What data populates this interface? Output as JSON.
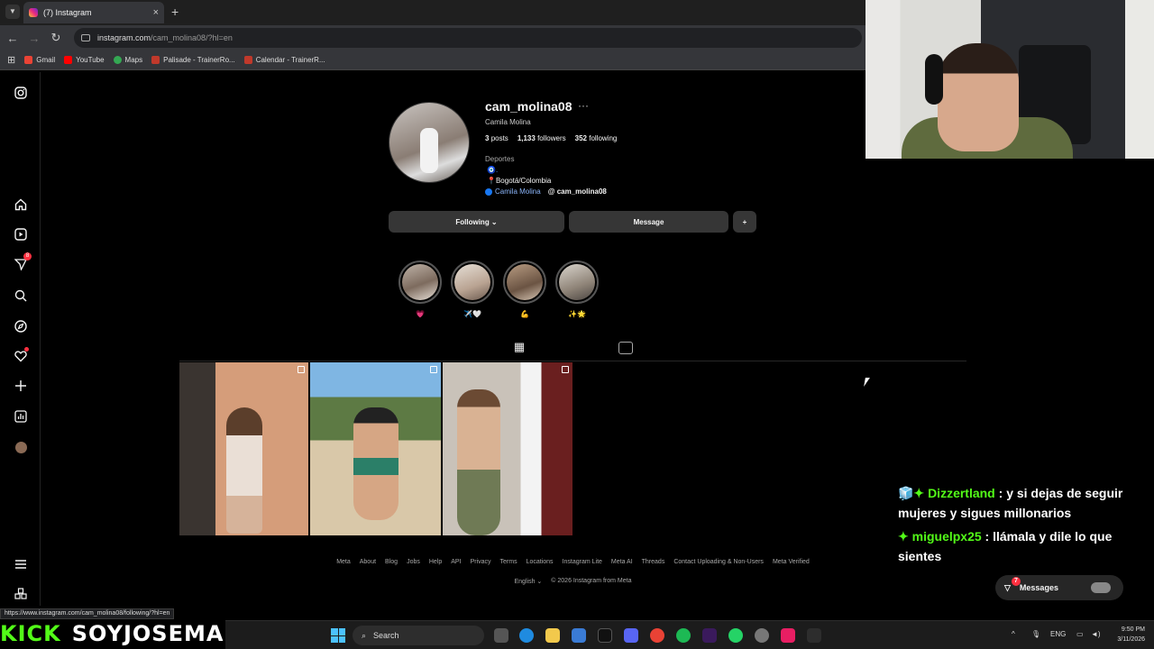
{
  "browser": {
    "tab_title": "(7) Instagram",
    "url_host": "instagram.com",
    "url_path": "/cam_molina08/?hl=en",
    "status_url": "https://www.instagram.com/cam_molina08/following/?hl=en",
    "bookmarks": [
      {
        "label": "Gmail",
        "color": "#ea4335"
      },
      {
        "label": "YouTube",
        "color": "#ff0000"
      },
      {
        "label": "Maps",
        "color": "#34a853"
      },
      {
        "label": "Palisade - TrainerRo...",
        "color": "#c0392b"
      },
      {
        "label": "Calendar - TrainerR...",
        "color": "#c0392b"
      }
    ]
  },
  "sidebar": {
    "nav_badge": "8",
    "icons": [
      "instagram-icon",
      "home-icon",
      "reels-icon",
      "messages-icon",
      "search-icon",
      "explore-icon",
      "notifications-icon",
      "create-icon",
      "dashboard-icon",
      "avatar",
      "menu-icon",
      "more-icon"
    ]
  },
  "profile": {
    "username": "cam_molina08",
    "more": "···",
    "full_name": "Camila Molina",
    "posts": "3",
    "posts_label": "posts",
    "followers": "1,133",
    "followers_label": "followers",
    "following": "352",
    "following_label": "following",
    "category": "Deportes",
    "bio_line1": "🧿.",
    "bio_line2": "Bogotá/Colombia",
    "fb_link": "Camila Molina",
    "threads_link": "cam_molina08",
    "following_button": "Following ⌄",
    "message_button": "Message",
    "add_user_button": "+"
  },
  "highlights": [
    {
      "caption": "💗"
    },
    {
      "caption": "✈️🤍"
    },
    {
      "caption": "💪"
    },
    {
      "caption": "✨🌟"
    }
  ],
  "footer": {
    "links": [
      "Meta",
      "About",
      "Blog",
      "Jobs",
      "Help",
      "API",
      "Privacy",
      "Terms",
      "Locations",
      "Instagram Lite",
      "Meta AI",
      "Threads",
      "Contact Uploading & Non-Users",
      "Meta Verified"
    ],
    "language": "English ⌄",
    "copyright": "© 2026 Instagram from Meta"
  },
  "chat": [
    {
      "prefix": "🧊✦",
      "user": "Dizzertland",
      "text": ": y si dejas de seguir mujeres y sigues millonarios"
    },
    {
      "prefix": "✦",
      "user": "miguelpx25",
      "text": ": llámala y dile lo que sientes"
    }
  ],
  "messages": {
    "label": "Messages",
    "badge": "7"
  },
  "overlay": {
    "kick": "KICK",
    "channel": "SOYJOSEMA"
  },
  "taskbar": {
    "search": "Search",
    "lang": "ENG",
    "time": "9:50 PM",
    "date": "3/11/2026"
  }
}
